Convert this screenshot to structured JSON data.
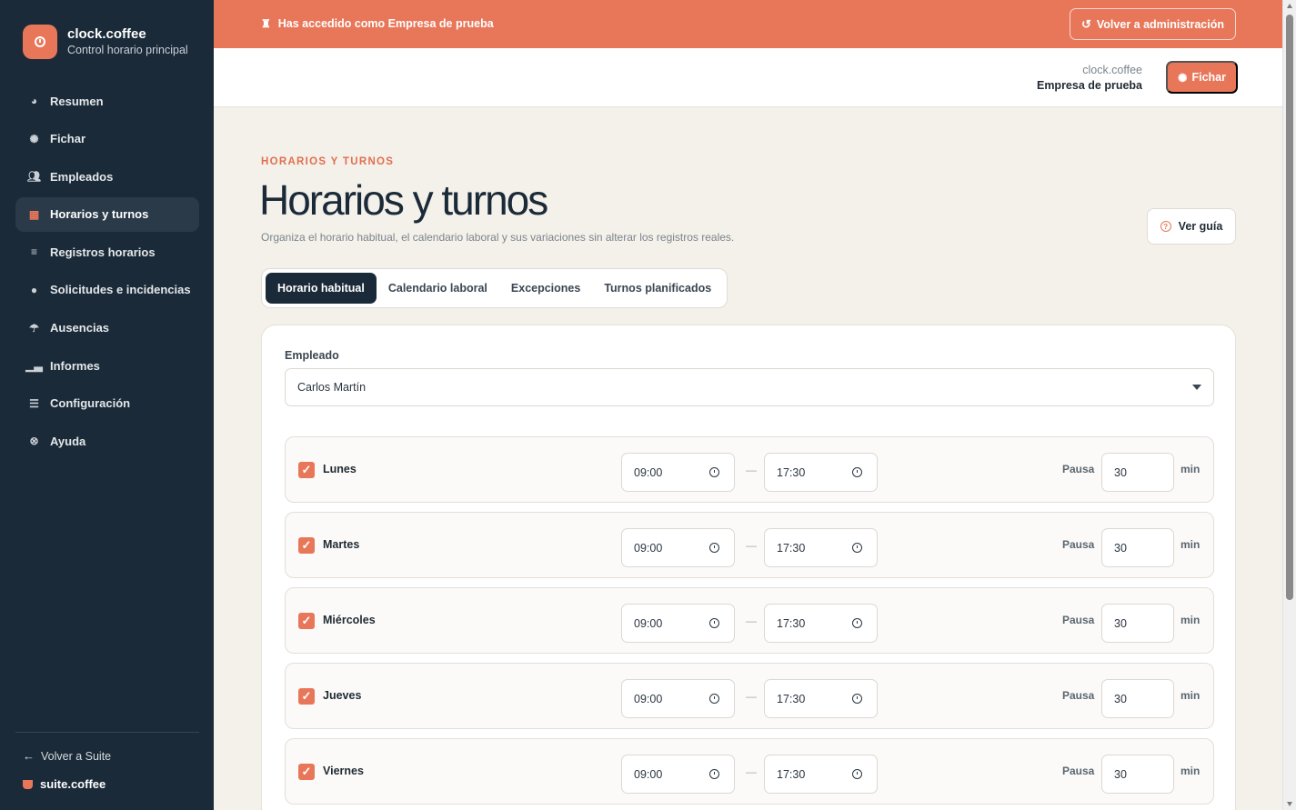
{
  "brand": {
    "name": "clock.coffee",
    "subtitle": "Control horario principal"
  },
  "nav": [
    {
      "label": "Resumen",
      "icon": "pie-chart-icon"
    },
    {
      "label": "Fichar",
      "icon": "fingerprint-icon"
    },
    {
      "label": "Empleados",
      "icon": "users-icon"
    },
    {
      "label": "Horarios y turnos",
      "icon": "calendar-icon",
      "active": true
    },
    {
      "label": "Registros horarios",
      "icon": "list-icon"
    },
    {
      "label": "Solicitudes e incidencias",
      "icon": "alert-circle-icon"
    },
    {
      "label": "Ausencias",
      "icon": "umbrella-icon"
    },
    {
      "label": "Informes",
      "icon": "bar-chart-icon"
    },
    {
      "label": "Configuración",
      "icon": "sliders-icon"
    },
    {
      "label": "Ayuda",
      "icon": "lifebuoy-icon"
    }
  ],
  "sidebar_footer": {
    "back_label": "Volver a Suite",
    "suite_label": "suite.coffee"
  },
  "banner": {
    "text": "Has accedido como Empresa de prueba",
    "admin_button": "Volver a administración"
  },
  "header": {
    "product": "clock.coffee",
    "company": "Empresa de prueba",
    "fichar_button": "Fichar"
  },
  "page": {
    "eyebrow": "HORARIOS Y TURNOS",
    "title": "Horarios y turnos",
    "subtitle": "Organiza el horario habitual, el calendario laboral y sus variaciones sin alterar los registros reales.",
    "guide_button": "Ver guía"
  },
  "tabs": [
    {
      "label": "Horario habitual",
      "active": true
    },
    {
      "label": "Calendario laboral"
    },
    {
      "label": "Excepciones"
    },
    {
      "label": "Turnos planificados"
    }
  ],
  "schedule": {
    "employee_label": "Empleado",
    "employee_value": "Carlos Martín",
    "pause_label": "Pausa",
    "min_label": "min",
    "dash": "—",
    "days": [
      {
        "name": "Lunes",
        "start": "09:00",
        "end": "17:30",
        "pause": "30",
        "checked": true
      },
      {
        "name": "Martes",
        "start": "09:00",
        "end": "17:30",
        "pause": "30",
        "checked": true
      },
      {
        "name": "Miércoles",
        "start": "09:00",
        "end": "17:30",
        "pause": "30",
        "checked": true
      },
      {
        "name": "Jueves",
        "start": "09:00",
        "end": "17:30",
        "pause": "30",
        "checked": true
      },
      {
        "name": "Viernes",
        "start": "09:00",
        "end": "17:30",
        "pause": "30",
        "checked": true
      }
    ]
  },
  "colors": {
    "accent": "#e8775a",
    "sidebar": "#1b2a38",
    "background": "#f4f0ea"
  }
}
